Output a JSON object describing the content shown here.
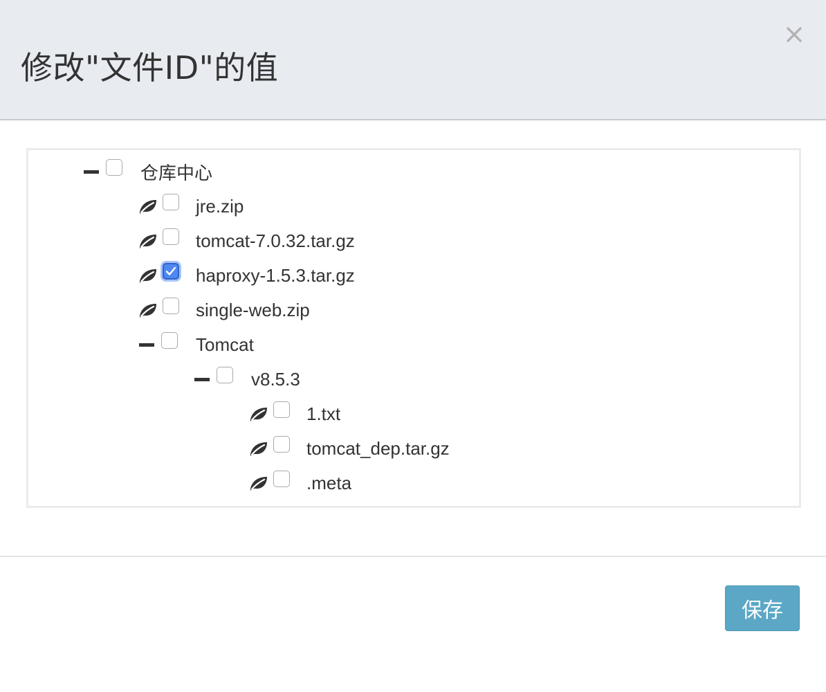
{
  "dialog": {
    "title": "修改\"文件ID\"的值",
    "close_icon": "close-icon",
    "save_label": "保存"
  },
  "tree": {
    "root": {
      "label": "仓库中心",
      "expanded": true,
      "checked": false
    },
    "files": [
      {
        "label": "jre.zip",
        "icon": "leaf-icon",
        "checked": false
      },
      {
        "label": "tomcat-7.0.32.tar.gz",
        "icon": "leaf-icon",
        "checked": false
      },
      {
        "label": "haproxy-1.5.3.tar.gz",
        "icon": "leaf-icon",
        "checked": true
      },
      {
        "label": "single-web.zip",
        "icon": "leaf-icon",
        "checked": false
      }
    ],
    "tomcat": {
      "label": "Tomcat",
      "expanded": true,
      "checked": false
    },
    "version": {
      "label": "v8.5.3",
      "expanded": true,
      "checked": false
    },
    "version_files": [
      {
        "label": "1.txt",
        "icon": "leaf-icon",
        "checked": false
      },
      {
        "label": "tomcat_dep.tar.gz",
        "icon": "leaf-icon",
        "checked": false
      },
      {
        "label": ".meta",
        "icon": "leaf-icon",
        "checked": false
      }
    ]
  },
  "colors": {
    "header_bg": "#e8ebf0",
    "checked": "#4f88f0",
    "save_button": "#5ba7c5"
  }
}
